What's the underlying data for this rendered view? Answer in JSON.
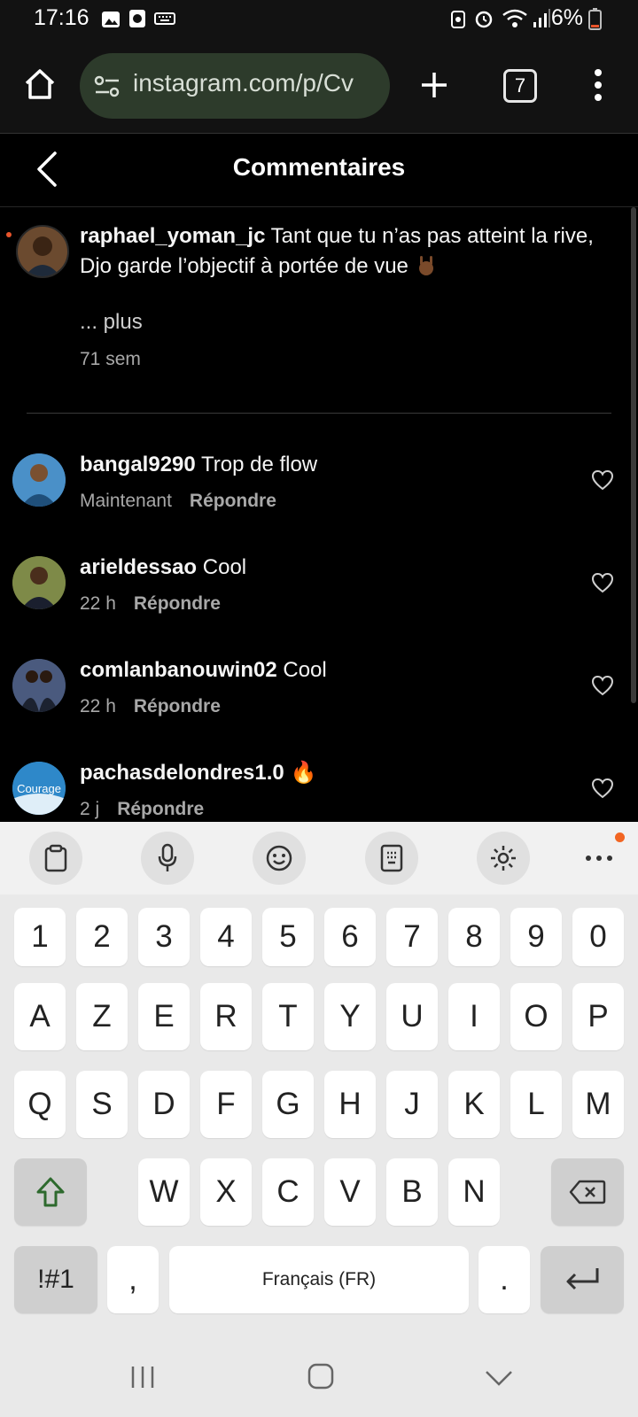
{
  "status_bar": {
    "time": "17:16",
    "battery": "6%"
  },
  "browser": {
    "url": "instagram.com/p/Cv",
    "tab_count": "7"
  },
  "header": {
    "title": "Commentaires"
  },
  "caption": {
    "username": "raphael_yoman_jc",
    "text_line1": "Tant que tu n’as pas atteint la rive,",
    "text_line2": "Djo garde l’objectif à portée de vue",
    "more": "... plus",
    "time": "71 sem"
  },
  "comments": [
    {
      "username": "bangal9290",
      "text": "Trop de flow",
      "time": "Maintenant",
      "reply": "Répondre",
      "avatar_color": "#3a7bb5"
    },
    {
      "username": "arieldessao",
      "text": "Cool",
      "time": "22 h",
      "reply": "Répondre",
      "avatar_color": "#6b7b3a"
    },
    {
      "username": "comlanbanouwin02",
      "text": "Cool",
      "time": "22 h",
      "reply": "Répondre",
      "avatar_color": "#3a4a6b"
    },
    {
      "username": "pachasdelondres1.0",
      "text": "🔥",
      "time": "2 j",
      "reply": "Répondre",
      "avatar_color": "#2e88c9",
      "avatar_text": "Courage"
    }
  ],
  "keyboard": {
    "row_numbers": [
      "1",
      "2",
      "3",
      "4",
      "5",
      "6",
      "7",
      "8",
      "9",
      "0"
    ],
    "row1": [
      "A",
      "Z",
      "E",
      "R",
      "T",
      "Y",
      "U",
      "I",
      "O",
      "P"
    ],
    "row2": [
      "Q",
      "S",
      "D",
      "F",
      "G",
      "H",
      "J",
      "K",
      "L",
      "M"
    ],
    "row3": [
      "W",
      "X",
      "C",
      "V",
      "B",
      "N"
    ],
    "symbols": "!#1",
    "comma": ",",
    "space": "Français (FR)",
    "period": "."
  }
}
